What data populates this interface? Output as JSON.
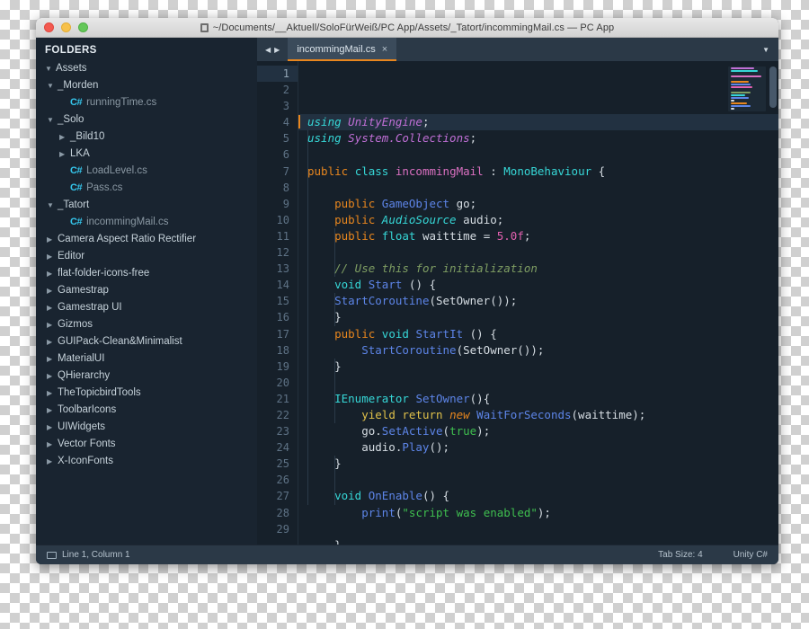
{
  "window": {
    "title": "~/Documents/__Aktuell/SoloFürWeiß/PC App/Assets/_Tatort/incommingMail.cs — PC App",
    "doc_icon": "document-icon",
    "traffic_lights": [
      "close",
      "minimize",
      "zoom"
    ]
  },
  "sidebar": {
    "header": "FOLDERS",
    "items": [
      {
        "label": "Assets",
        "depth": 0,
        "type": "folder",
        "state": "open"
      },
      {
        "label": "_Morden",
        "depth": 1,
        "type": "folder",
        "state": "open"
      },
      {
        "label": "runningTime.cs",
        "depth": 2,
        "type": "file",
        "state": "none"
      },
      {
        "label": "_Solo",
        "depth": 1,
        "type": "folder",
        "state": "open"
      },
      {
        "label": "_Bild10",
        "depth": 2,
        "type": "folder",
        "state": "closed"
      },
      {
        "label": "LKA",
        "depth": 2,
        "type": "folder",
        "state": "closed"
      },
      {
        "label": "LoadLevel.cs",
        "depth": 2,
        "type": "file",
        "state": "none"
      },
      {
        "label": "Pass.cs",
        "depth": 2,
        "type": "file",
        "state": "none"
      },
      {
        "label": "_Tatort",
        "depth": 1,
        "type": "folder",
        "state": "open"
      },
      {
        "label": "incommingMail.cs",
        "depth": 2,
        "type": "file",
        "state": "none"
      },
      {
        "label": "Camera Aspect Ratio Rectifier",
        "depth": 1,
        "type": "folder",
        "state": "closed"
      },
      {
        "label": "Editor",
        "depth": 1,
        "type": "folder",
        "state": "closed"
      },
      {
        "label": "flat-folder-icons-free",
        "depth": 1,
        "type": "folder",
        "state": "closed"
      },
      {
        "label": "Gamestrap",
        "depth": 1,
        "type": "folder",
        "state": "closed"
      },
      {
        "label": "Gamestrap UI",
        "depth": 1,
        "type": "folder",
        "state": "closed"
      },
      {
        "label": "Gizmos",
        "depth": 1,
        "type": "folder",
        "state": "closed"
      },
      {
        "label": "GUIPack-Clean&Minimalist",
        "depth": 1,
        "type": "folder",
        "state": "closed"
      },
      {
        "label": "MaterialUI",
        "depth": 1,
        "type": "folder",
        "state": "closed"
      },
      {
        "label": "QHierarchy",
        "depth": 1,
        "type": "folder",
        "state": "closed"
      },
      {
        "label": "TheTopicbirdTools",
        "depth": 1,
        "type": "folder",
        "state": "closed"
      },
      {
        "label": "ToolbarIcons",
        "depth": 1,
        "type": "folder",
        "state": "closed"
      },
      {
        "label": "UIWidgets",
        "depth": 1,
        "type": "folder",
        "state": "closed"
      },
      {
        "label": "Vector Fonts",
        "depth": 1,
        "type": "folder",
        "state": "closed"
      },
      {
        "label": "X-IconFonts",
        "depth": 1,
        "type": "folder",
        "state": "closed"
      }
    ],
    "file_icon_label": "C#"
  },
  "tabbar": {
    "nav_prev": "◀",
    "nav_next": "▶",
    "tabs": [
      {
        "label": "incommingMail.cs",
        "close": "×",
        "active": true
      }
    ],
    "menu_icon": "▼"
  },
  "editor": {
    "total_lines": 29,
    "active_line": 1,
    "line_numbers": [
      1,
      2,
      3,
      4,
      5,
      6,
      7,
      8,
      9,
      10,
      11,
      12,
      13,
      14,
      15,
      16,
      17,
      18,
      19,
      20,
      21,
      22,
      23,
      24,
      25,
      26,
      27,
      28,
      29
    ],
    "lines": [
      {
        "n": 1,
        "tokens": [
          {
            "t": "using",
            "c": "ki"
          },
          {
            "t": " ",
            "c": "pl"
          },
          {
            "t": "UnityEngine",
            "c": "ns"
          },
          {
            "t": ";",
            "c": "pl"
          }
        ]
      },
      {
        "n": 2,
        "tokens": [
          {
            "t": "using",
            "c": "ki"
          },
          {
            "t": " ",
            "c": "pl"
          },
          {
            "t": "System.Collections",
            "c": "ns"
          },
          {
            "t": ";",
            "c": "pl"
          }
        ]
      },
      {
        "n": 3,
        "tokens": []
      },
      {
        "n": 4,
        "tokens": [
          {
            "t": "public",
            "c": "mod"
          },
          {
            "t": " ",
            "c": "pl"
          },
          {
            "t": "class",
            "c": "k"
          },
          {
            "t": " ",
            "c": "pl"
          },
          {
            "t": "incommingMail",
            "c": "type"
          },
          {
            "t": " : ",
            "c": "pl"
          },
          {
            "t": "MonoBehaviour",
            "c": "typ2"
          },
          {
            "t": " {",
            "c": "pl"
          }
        ]
      },
      {
        "n": 5,
        "tokens": []
      },
      {
        "n": 6,
        "tokens": [
          {
            "t": "    ",
            "c": "pl"
          },
          {
            "t": "public",
            "c": "mod"
          },
          {
            "t": " ",
            "c": "pl"
          },
          {
            "t": "GameObject",
            "c": "tb"
          },
          {
            "t": " go;",
            "c": "pl"
          }
        ]
      },
      {
        "n": 7,
        "tokens": [
          {
            "t": "    ",
            "c": "pl"
          },
          {
            "t": "public",
            "c": "mod"
          },
          {
            "t": " ",
            "c": "pl"
          },
          {
            "t": "AudioSource",
            "c": "ti"
          },
          {
            "t": " audio;",
            "c": "pl"
          }
        ]
      },
      {
        "n": 8,
        "tokens": [
          {
            "t": "    ",
            "c": "pl"
          },
          {
            "t": "public",
            "c": "mod"
          },
          {
            "t": " ",
            "c": "pl"
          },
          {
            "t": "float",
            "c": "k"
          },
          {
            "t": " waittime = ",
            "c": "pl"
          },
          {
            "t": "5.0f",
            "c": "num"
          },
          {
            "t": ";",
            "c": "pl"
          }
        ]
      },
      {
        "n": 9,
        "tokens": []
      },
      {
        "n": 10,
        "tokens": [
          {
            "t": "    ",
            "c": "pl"
          },
          {
            "t": "// Use this for initialization",
            "c": "cmt"
          }
        ]
      },
      {
        "n": 11,
        "tokens": [
          {
            "t": "    ",
            "c": "pl"
          },
          {
            "t": "void",
            "c": "k"
          },
          {
            "t": " ",
            "c": "pl"
          },
          {
            "t": "Start",
            "c": "fn"
          },
          {
            "t": " () {",
            "c": "pl"
          }
        ]
      },
      {
        "n": 12,
        "tokens": [
          {
            "t": "    ",
            "c": "pl"
          },
          {
            "t": "StartCoroutine",
            "c": "fn"
          },
          {
            "t": "(SetOwner());",
            "c": "pl"
          }
        ]
      },
      {
        "n": 13,
        "tokens": [
          {
            "t": "    }",
            "c": "pl"
          }
        ]
      },
      {
        "n": 14,
        "tokens": [
          {
            "t": "    ",
            "c": "pl"
          },
          {
            "t": "public",
            "c": "mod"
          },
          {
            "t": " ",
            "c": "pl"
          },
          {
            "t": "void",
            "c": "k"
          },
          {
            "t": " ",
            "c": "pl"
          },
          {
            "t": "StartIt",
            "c": "fn"
          },
          {
            "t": " () {",
            "c": "pl"
          }
        ]
      },
      {
        "n": 15,
        "tokens": [
          {
            "t": "        ",
            "c": "pl"
          },
          {
            "t": "StartCoroutine",
            "c": "fn"
          },
          {
            "t": "(SetOwner());",
            "c": "pl"
          }
        ]
      },
      {
        "n": 16,
        "tokens": [
          {
            "t": "    }",
            "c": "pl"
          }
        ]
      },
      {
        "n": 17,
        "tokens": []
      },
      {
        "n": 18,
        "tokens": [
          {
            "t": "    ",
            "c": "pl"
          },
          {
            "t": "IEnumerator",
            "c": "k"
          },
          {
            "t": " ",
            "c": "pl"
          },
          {
            "t": "SetOwner",
            "c": "fn"
          },
          {
            "t": "(){",
            "c": "pl"
          }
        ]
      },
      {
        "n": 19,
        "tokens": [
          {
            "t": "        ",
            "c": "pl"
          },
          {
            "t": "yield return",
            "c": "yld"
          },
          {
            "t": " ",
            "c": "pl"
          },
          {
            "t": "new",
            "c": "nw"
          },
          {
            "t": " ",
            "c": "pl"
          },
          {
            "t": "WaitForSeconds",
            "c": "fn"
          },
          {
            "t": "(waittime);",
            "c": "pl"
          }
        ]
      },
      {
        "n": 20,
        "tokens": [
          {
            "t": "        go.",
            "c": "pl"
          },
          {
            "t": "SetActive",
            "c": "fn"
          },
          {
            "t": "(",
            "c": "pl"
          },
          {
            "t": "true",
            "c": "bool"
          },
          {
            "t": ");",
            "c": "pl"
          }
        ]
      },
      {
        "n": 21,
        "tokens": [
          {
            "t": "        audio.",
            "c": "pl"
          },
          {
            "t": "Play",
            "c": "fn"
          },
          {
            "t": "();",
            "c": "pl"
          }
        ]
      },
      {
        "n": 22,
        "tokens": [
          {
            "t": "    }",
            "c": "pl"
          }
        ]
      },
      {
        "n": 23,
        "tokens": []
      },
      {
        "n": 24,
        "tokens": [
          {
            "t": "    ",
            "c": "pl"
          },
          {
            "t": "void",
            "c": "k"
          },
          {
            "t": " ",
            "c": "pl"
          },
          {
            "t": "OnEnable",
            "c": "fn"
          },
          {
            "t": "() {",
            "c": "pl"
          }
        ]
      },
      {
        "n": 25,
        "tokens": [
          {
            "t": "        ",
            "c": "pl"
          },
          {
            "t": "print",
            "c": "fn"
          },
          {
            "t": "(",
            "c": "pl"
          },
          {
            "t": "\"script was enabled\"",
            "c": "str"
          },
          {
            "t": ");",
            "c": "pl"
          }
        ]
      },
      {
        "n": 26,
        "tokens": []
      },
      {
        "n": 27,
        "tokens": [
          {
            "t": "    }",
            "c": "pl"
          }
        ]
      },
      {
        "n": 28,
        "tokens": [
          {
            "t": "}",
            "c": "pl"
          }
        ]
      },
      {
        "n": 29,
        "tokens": []
      }
    ],
    "minimap_lines": [
      {
        "w": 26,
        "c": "#c06fd6"
      },
      {
        "w": 30,
        "c": "#36d7d7"
      },
      {
        "w": 0,
        "c": "transparent"
      },
      {
        "w": 34,
        "c": "#d96fc0"
      },
      {
        "w": 0,
        "c": "transparent"
      },
      {
        "w": 20,
        "c": "#e8861e"
      },
      {
        "w": 22,
        "c": "#5d85e8"
      },
      {
        "w": 24,
        "c": "#e361b0"
      },
      {
        "w": 0,
        "c": "transparent"
      },
      {
        "w": 22,
        "c": "#7f9e63"
      },
      {
        "w": 16,
        "c": "#36d7d7"
      },
      {
        "w": 20,
        "c": "#5d85e8"
      },
      {
        "w": 4,
        "c": "#d6dde3"
      },
      {
        "w": 18,
        "c": "#e8861e"
      },
      {
        "w": 22,
        "c": "#5d85e8"
      },
      {
        "w": 4,
        "c": "#d6dde3"
      },
      {
        "w": 0,
        "c": "transparent"
      },
      {
        "w": 20,
        "c": "#36d7d7"
      },
      {
        "w": 30,
        "c": "#e0c14a"
      },
      {
        "w": 18,
        "c": "#3fbf4f"
      },
      {
        "w": 14,
        "c": "#5d85e8"
      },
      {
        "w": 4,
        "c": "#d6dde3"
      }
    ]
  },
  "statusbar": {
    "position_icon": "display-icon",
    "position": "Line 1, Column 1",
    "tab_size": "Tab Size: 4",
    "syntax": "Unity C#"
  },
  "colors": {
    "accent_orange": "#e8861e",
    "window_bg": "#1b2733",
    "sidebar_bg": "#192430",
    "editor_bg": "#16202a",
    "tabbar_bg": "#2b3947"
  }
}
